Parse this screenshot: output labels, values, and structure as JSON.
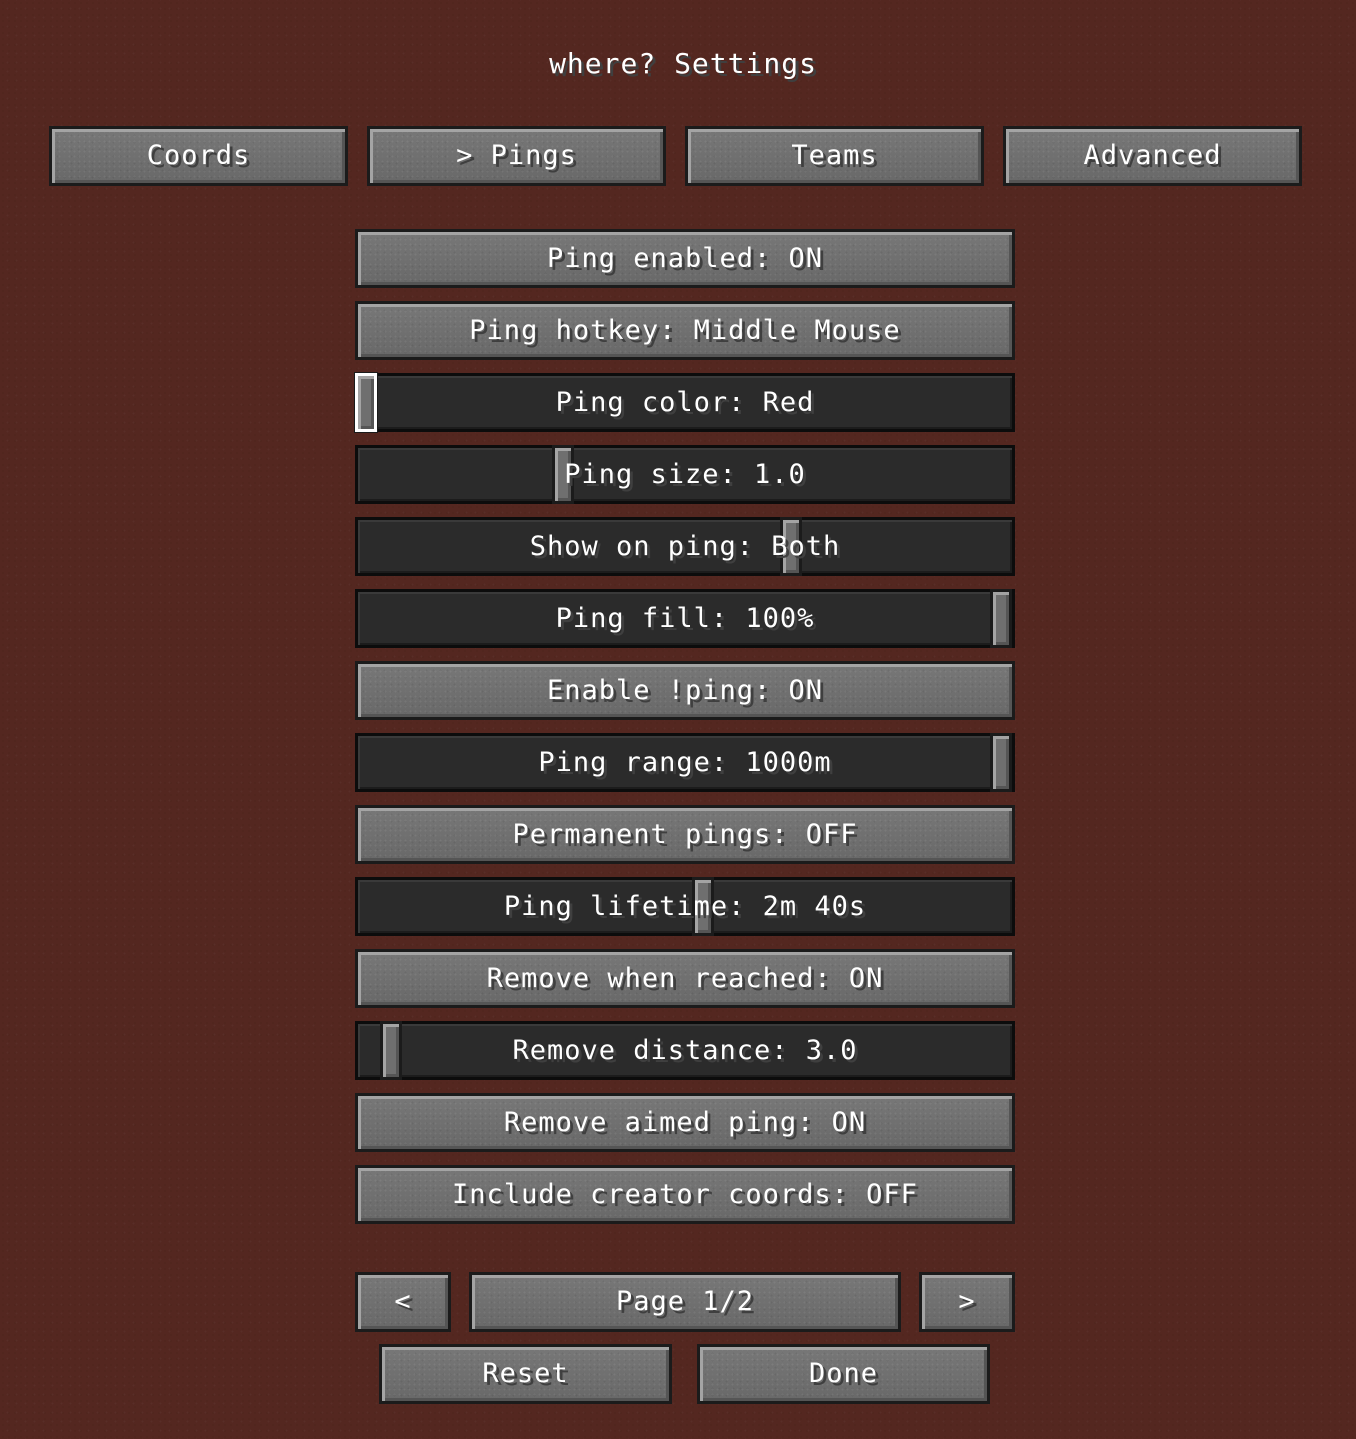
{
  "screen": {
    "title": "where? Settings"
  },
  "tabs": [
    {
      "label": "Coords"
    },
    {
      "label": "> Pings"
    },
    {
      "label": "Teams"
    },
    {
      "label": "Advanced"
    }
  ],
  "options": {
    "ping_enabled": "Ping enabled: ON",
    "ping_hotkey": "Ping hotkey: Middle Mouse",
    "ping_color": {
      "label": "Ping color: Red",
      "position": 0.0
    },
    "ping_size": {
      "label": "Ping size: 1.0",
      "position": 0.31
    },
    "show_on_ping": {
      "label": "Show on ping: Both",
      "position": 0.67
    },
    "ping_fill": {
      "label": "Ping fill: 100%",
      "position": 1.0
    },
    "enable_bang_ping": "Enable !ping: ON",
    "ping_range": {
      "label": "Ping range: 1000m",
      "position": 1.0
    },
    "permanent_pings": "Permanent pings: OFF",
    "ping_lifetime": {
      "label": "Ping lifetime: 2m 40s",
      "position": 0.53
    },
    "remove_when_reached": "Remove when reached: ON",
    "remove_distance": {
      "label": "Remove distance: 3.0",
      "position": 0.04
    },
    "remove_aimed_ping": "Remove aimed ping: ON",
    "include_creator_coords": "Include creator coords: OFF"
  },
  "pagination": {
    "prev_label": "<",
    "page_label": "Page 1/2",
    "next_label": ">"
  },
  "footer": {
    "reset_label": "Reset",
    "done_label": "Done"
  }
}
